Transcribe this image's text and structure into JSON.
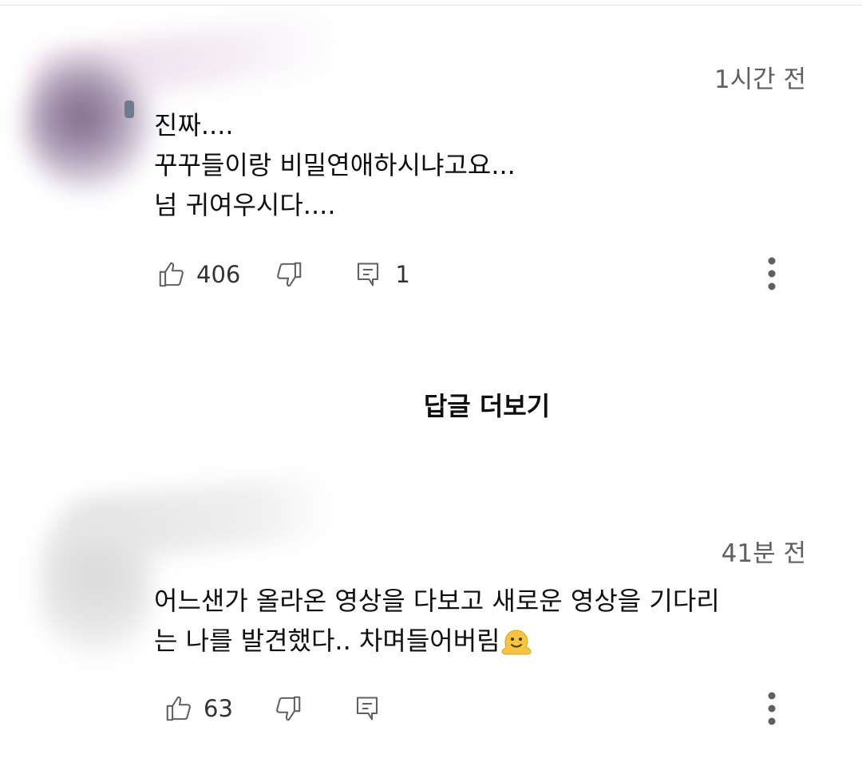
{
  "comments": [
    {
      "author_redacted": true,
      "time": "1시간 전",
      "lines": [
        "진짜....",
        "꾸꾸들이랑 비밀연애하시냐고요...",
        "넘 귀여우시다...."
      ],
      "likes": "406",
      "replies": "1",
      "icons": [
        "thumb-up-icon",
        "thumb-down-icon",
        "reply-icon",
        "more-vert-icon"
      ]
    },
    {
      "author_redacted": true,
      "time": "41분 전",
      "lines": [
        "어느샌가 올라온 영상을 다보고 새로운 영상을 기다리",
        "는 나를 발견했다.. 차며들어버림"
      ],
      "emoji": "melting-face-icon",
      "likes": "63",
      "icons": [
        "thumb-up-icon",
        "thumb-down-icon",
        "reply-icon",
        "more-vert-icon"
      ]
    }
  ],
  "more_replies_label": "답글 더보기",
  "colors": {
    "text_primary": "#0f0f0f",
    "text_secondary": "#606060",
    "icon": "#606060",
    "emoji": "#f5c542"
  }
}
